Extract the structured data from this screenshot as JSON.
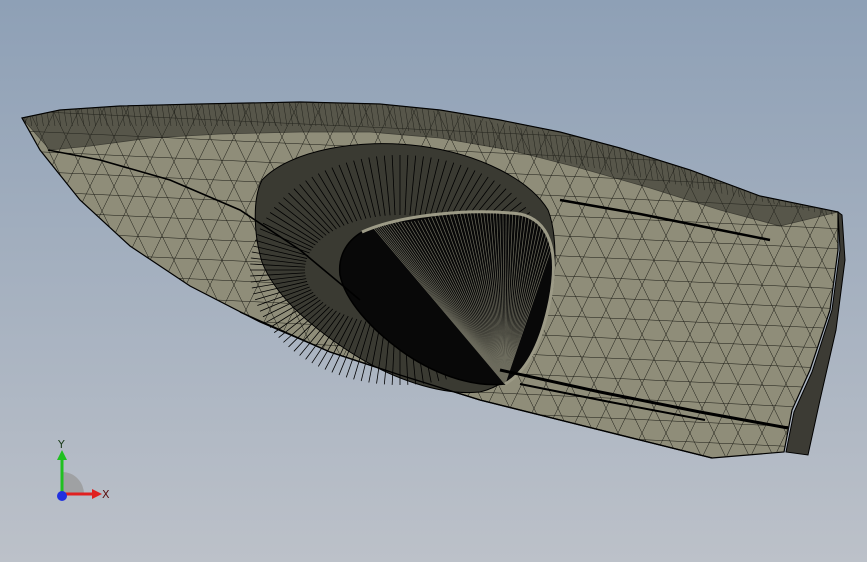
{
  "viewport": {
    "background_top": "#8ea0b6",
    "background_bottom": "#bcc1c9"
  },
  "model": {
    "shading_color": "#8e8c78",
    "edge_color": "#000000",
    "display_style": "shaded-with-edges-mesh"
  },
  "triad": {
    "x_label": "X",
    "y_label": "Y",
    "x_color": "#e02020",
    "y_color": "#20c020",
    "z_color": "#2030e0"
  }
}
